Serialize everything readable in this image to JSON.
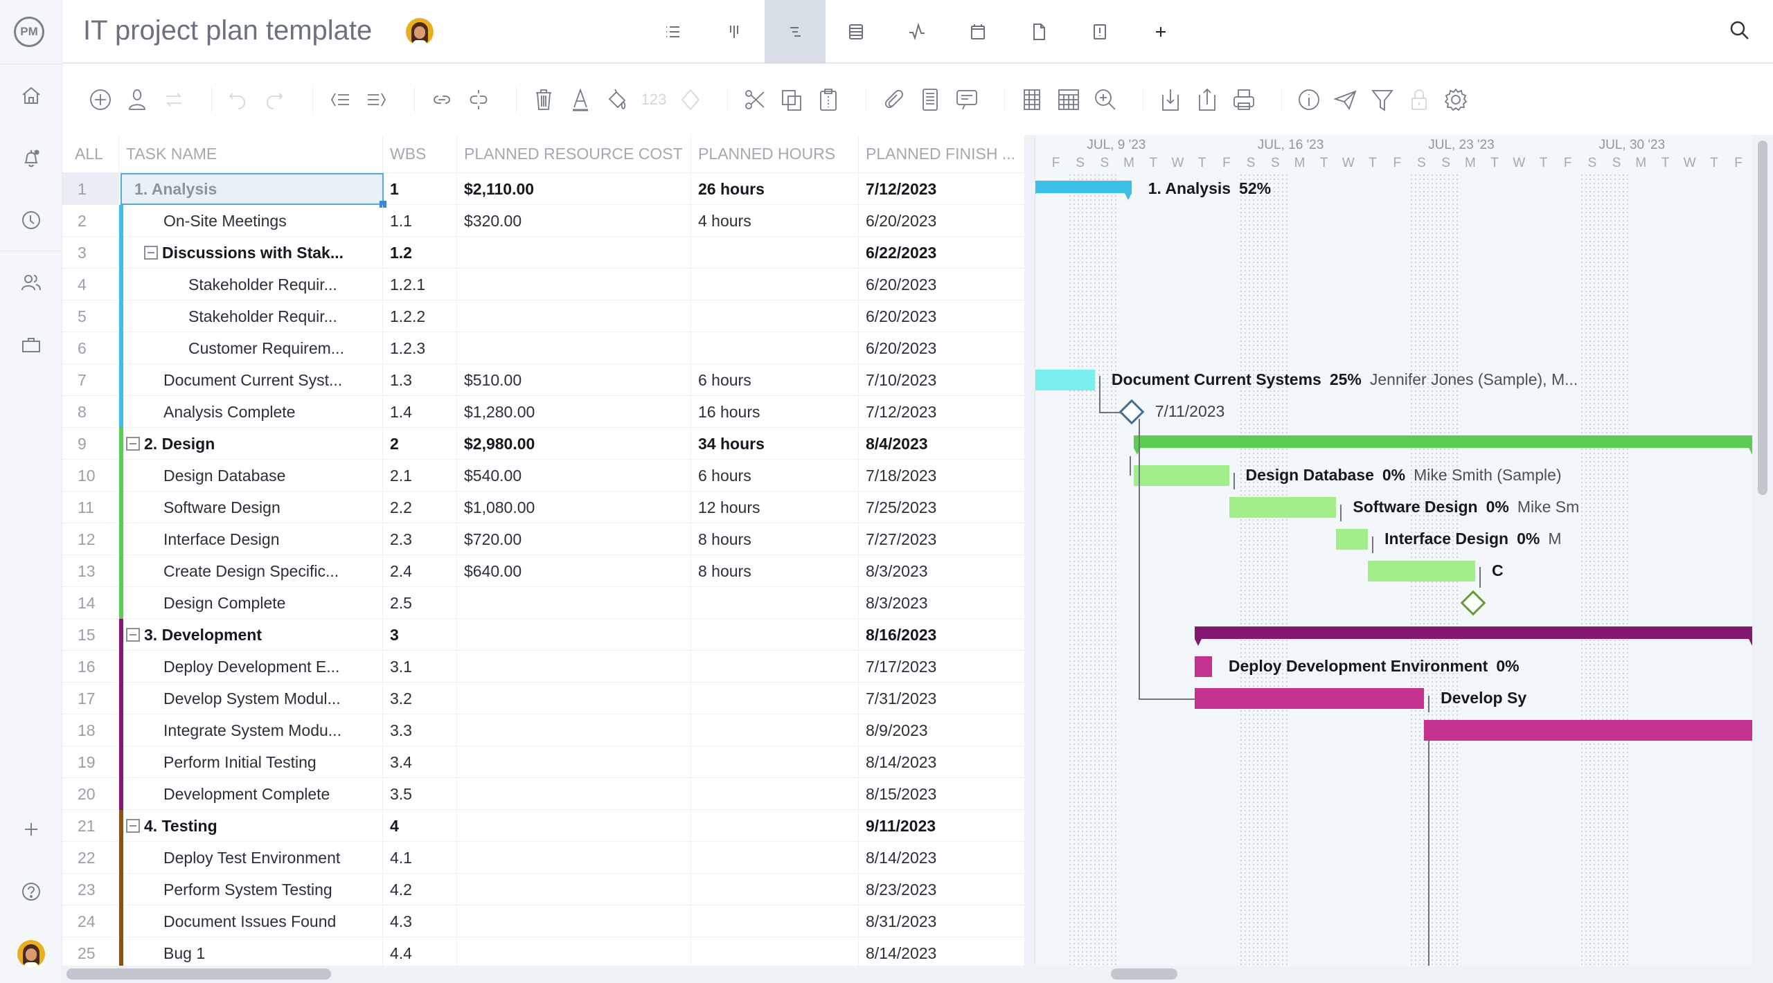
{
  "app": {
    "logo": "PM",
    "title": "IT project plan template"
  },
  "sidebar": {
    "items": [
      {
        "name": "home",
        "icon": "home-icon"
      },
      {
        "name": "notifications",
        "icon": "bell-icon"
      },
      {
        "name": "timesheets",
        "icon": "clock-icon"
      },
      {
        "name": "team",
        "icon": "users-icon"
      },
      {
        "name": "portfolio",
        "icon": "briefcase-icon"
      }
    ],
    "bottom": [
      {
        "name": "add",
        "icon": "plus-icon"
      },
      {
        "name": "help",
        "icon": "help-icon"
      },
      {
        "name": "profile",
        "icon": "avatar"
      }
    ]
  },
  "view_tabs": [
    {
      "name": "list",
      "icon": "list-icon",
      "active": false
    },
    {
      "name": "board",
      "icon": "board-icon",
      "active": false
    },
    {
      "name": "gantt",
      "icon": "gantt-icon",
      "active": true
    },
    {
      "name": "sheet",
      "icon": "sheet-icon",
      "active": false
    },
    {
      "name": "dashboard",
      "icon": "pulse-icon",
      "active": false
    },
    {
      "name": "calendar",
      "icon": "calendar-icon",
      "active": false
    },
    {
      "name": "files",
      "icon": "file-icon",
      "active": false
    },
    {
      "name": "risks",
      "icon": "alert-icon",
      "active": false
    },
    {
      "name": "add-view",
      "icon": "plus-icon",
      "active": false
    }
  ],
  "toolbar": {
    "number_format_label": "123",
    "buttons": [
      "add-task",
      "add-resource",
      "recurring",
      "undo",
      "redo",
      "outdent",
      "indent",
      "link",
      "unlink",
      "delete",
      "font-color",
      "fill-color",
      "number-format",
      "milestone",
      "cut",
      "copy",
      "paste",
      "attachment",
      "notes",
      "comments",
      "columns",
      "grid",
      "zoom",
      "import",
      "export",
      "print",
      "info",
      "share",
      "filter",
      "lock",
      "settings"
    ]
  },
  "grid": {
    "columns": {
      "all": "ALL",
      "task": "TASK NAME",
      "wbs": "WBS",
      "cost": "PLANNED RESOURCE COST",
      "hours": "PLANNED HOURS",
      "finish": "PLANNED FINISH ..."
    },
    "rows": [
      {
        "num": "1",
        "task": "1. Analysis",
        "wbs": "1",
        "cost": "$2,110.00",
        "hours": "26 hours",
        "finish": "7/12/2023",
        "level": 0,
        "bold": true,
        "group": "analysis",
        "collapsible": false,
        "selected": true
      },
      {
        "num": "2",
        "task": "On-Site Meetings",
        "wbs": "1.1",
        "cost": "$320.00",
        "hours": "4 hours",
        "finish": "6/20/2023",
        "level": 1,
        "bold": false,
        "group": "analysis"
      },
      {
        "num": "3",
        "task": "Discussions with Stak...",
        "wbs": "1.2",
        "cost": "",
        "hours": "",
        "finish": "6/22/2023",
        "level": 1,
        "bold": true,
        "group": "analysis",
        "collapsible": true
      },
      {
        "num": "4",
        "task": "Stakeholder Requir...",
        "wbs": "1.2.1",
        "cost": "",
        "hours": "",
        "finish": "6/20/2023",
        "level": 2,
        "bold": false,
        "group": "analysis"
      },
      {
        "num": "5",
        "task": "Stakeholder Requir...",
        "wbs": "1.2.2",
        "cost": "",
        "hours": "",
        "finish": "6/20/2023",
        "level": 2,
        "bold": false,
        "group": "analysis"
      },
      {
        "num": "6",
        "task": "Customer Requirem...",
        "wbs": "1.2.3",
        "cost": "",
        "hours": "",
        "finish": "6/20/2023",
        "level": 2,
        "bold": false,
        "group": "analysis"
      },
      {
        "num": "7",
        "task": "Document Current Syst...",
        "wbs": "1.3",
        "cost": "$510.00",
        "hours": "6 hours",
        "finish": "7/10/2023",
        "level": 1,
        "bold": false,
        "group": "analysis"
      },
      {
        "num": "8",
        "task": "Analysis Complete",
        "wbs": "1.4",
        "cost": "$1,280.00",
        "hours": "16 hours",
        "finish": "7/12/2023",
        "level": 1,
        "bold": false,
        "group": "analysis"
      },
      {
        "num": "9",
        "task": "2. Design",
        "wbs": "2",
        "cost": "$2,980.00",
        "hours": "34 hours",
        "finish": "8/4/2023",
        "level": 0,
        "bold": true,
        "group": "design",
        "collapsible": true
      },
      {
        "num": "10",
        "task": "Design Database",
        "wbs": "2.1",
        "cost": "$540.00",
        "hours": "6 hours",
        "finish": "7/18/2023",
        "level": 1,
        "bold": false,
        "group": "design"
      },
      {
        "num": "11",
        "task": "Software Design",
        "wbs": "2.2",
        "cost": "$1,080.00",
        "hours": "12 hours",
        "finish": "7/25/2023",
        "level": 1,
        "bold": false,
        "group": "design"
      },
      {
        "num": "12",
        "task": "Interface Design",
        "wbs": "2.3",
        "cost": "$720.00",
        "hours": "8 hours",
        "finish": "7/27/2023",
        "level": 1,
        "bold": false,
        "group": "design"
      },
      {
        "num": "13",
        "task": "Create Design Specific...",
        "wbs": "2.4",
        "cost": "$640.00",
        "hours": "8 hours",
        "finish": "8/3/2023",
        "level": 1,
        "bold": false,
        "group": "design"
      },
      {
        "num": "14",
        "task": "Design Complete",
        "wbs": "2.5",
        "cost": "",
        "hours": "",
        "finish": "8/3/2023",
        "level": 1,
        "bold": false,
        "group": "design"
      },
      {
        "num": "15",
        "task": "3. Development",
        "wbs": "3",
        "cost": "",
        "hours": "",
        "finish": "8/16/2023",
        "level": 0,
        "bold": true,
        "group": "development",
        "collapsible": true
      },
      {
        "num": "16",
        "task": "Deploy Development E...",
        "wbs": "3.1",
        "cost": "",
        "hours": "",
        "finish": "7/17/2023",
        "level": 1,
        "bold": false,
        "group": "development"
      },
      {
        "num": "17",
        "task": "Develop System Modul...",
        "wbs": "3.2",
        "cost": "",
        "hours": "",
        "finish": "7/31/2023",
        "level": 1,
        "bold": false,
        "group": "development"
      },
      {
        "num": "18",
        "task": "Integrate System Modu...",
        "wbs": "3.3",
        "cost": "",
        "hours": "",
        "finish": "8/9/2023",
        "level": 1,
        "bold": false,
        "group": "development"
      },
      {
        "num": "19",
        "task": "Perform Initial Testing",
        "wbs": "3.4",
        "cost": "",
        "hours": "",
        "finish": "8/14/2023",
        "level": 1,
        "bold": false,
        "group": "development"
      },
      {
        "num": "20",
        "task": "Development Complete",
        "wbs": "3.5",
        "cost": "",
        "hours": "",
        "finish": "8/15/2023",
        "level": 1,
        "bold": false,
        "group": "development"
      },
      {
        "num": "21",
        "task": "4. Testing",
        "wbs": "4",
        "cost": "",
        "hours": "",
        "finish": "9/11/2023",
        "level": 0,
        "bold": true,
        "group": "testing",
        "collapsible": true
      },
      {
        "num": "22",
        "task": "Deploy Test Environment",
        "wbs": "4.1",
        "cost": "",
        "hours": "",
        "finish": "8/14/2023",
        "level": 1,
        "bold": false,
        "group": "testing"
      },
      {
        "num": "23",
        "task": "Perform System Testing",
        "wbs": "4.2",
        "cost": "",
        "hours": "",
        "finish": "8/23/2023",
        "level": 1,
        "bold": false,
        "group": "testing"
      },
      {
        "num": "24",
        "task": "Document Issues Found",
        "wbs": "4.3",
        "cost": "",
        "hours": "",
        "finish": "8/31/2023",
        "level": 1,
        "bold": false,
        "group": "testing"
      },
      {
        "num": "25",
        "task": "Bug 1",
        "wbs": "4.4",
        "cost": "",
        "hours": "",
        "finish": "8/14/2023",
        "level": 1,
        "bold": false,
        "group": "testing"
      }
    ]
  },
  "colors": {
    "analysis": "#3bbfe6",
    "analysis_task": "#7aefed",
    "analysis_milestone": "#3f6f95",
    "design": "#5ccd52",
    "design_task": "#a2ee8a",
    "design_milestone": "#6a9a3a",
    "development": "#82196f",
    "development_task": "#c4318f",
    "testing": "#8a5410",
    "accent": "#2e8de0"
  },
  "gantt": {
    "months": [
      {
        "label": "JUL, 9 '23",
        "day": 2
      },
      {
        "label": "JUL, 16 '23",
        "day": 9
      },
      {
        "label": "JUL, 23 '23",
        "day": 16
      },
      {
        "label": "JUL, 30 '23",
        "day": 23
      }
    ],
    "days": [
      "F",
      "S",
      "S",
      "M",
      "T",
      "W",
      "T",
      "F",
      "S",
      "S",
      "M",
      "T",
      "W",
      "T",
      "F",
      "S",
      "S",
      "M",
      "T",
      "W",
      "T",
      "F",
      "S",
      "S",
      "M",
      "T",
      "W",
      "T",
      "F"
    ],
    "bars": [
      {
        "row": 0,
        "type": "summary",
        "start": -0.6,
        "end": 3.6,
        "color": "analysis",
        "name": "1. Analysis",
        "pct": "52%",
        "resources": ""
      },
      {
        "row": 6,
        "type": "task",
        "start": -0.6,
        "end": 2.1,
        "color": "analysis_task",
        "name": "Document Current Systems",
        "pct": "25%",
        "resources": "Jennifer Jones (Sample), M..."
      },
      {
        "row": 7,
        "type": "milestone",
        "at": 3.6,
        "color": "analysis_milestone",
        "date": "7/11/2023"
      },
      {
        "row": 8,
        "type": "summary",
        "start": 3.7,
        "end": 29.2,
        "color": "design",
        "name": "",
        "pct": "",
        "resources": ""
      },
      {
        "row": 9,
        "type": "task",
        "start": 3.7,
        "end": 7.6,
        "color": "design_task",
        "name": "Design Database",
        "pct": "0%",
        "resources": "Mike Smith (Sample)"
      },
      {
        "row": 10,
        "type": "task",
        "start": 7.6,
        "end": 12.0,
        "color": "design_task",
        "name": "Software Design",
        "pct": "0%",
        "resources": "Mike Sm"
      },
      {
        "row": 11,
        "type": "task",
        "start": 12.0,
        "end": 13.3,
        "color": "design_task",
        "name": "Interface Design",
        "pct": "0%",
        "resources": "M"
      },
      {
        "row": 12,
        "type": "task",
        "start": 13.3,
        "end": 17.7,
        "color": "design_task",
        "name": "C",
        "pct": "",
        "resources": ""
      },
      {
        "row": 13,
        "type": "milestone",
        "at": 17.6,
        "color": "design_milestone",
        "date": ""
      },
      {
        "row": 14,
        "type": "summary",
        "start": 6.2,
        "end": 29.2,
        "color": "development",
        "name": "",
        "pct": "",
        "resources": ""
      },
      {
        "row": 15,
        "type": "task",
        "start": 6.2,
        "end": 6.9,
        "color": "development_task",
        "name": "Deploy Development Environment",
        "pct": "0%",
        "resources": ""
      },
      {
        "row": 16,
        "type": "task",
        "start": 6.2,
        "end": 15.6,
        "color": "development_task",
        "name": "Develop Sy",
        "pct": "",
        "resources": ""
      },
      {
        "row": 17,
        "type": "task",
        "start": 15.6,
        "end": 29.2,
        "color": "development_task",
        "name": "",
        "pct": "",
        "resources": ""
      }
    ]
  }
}
